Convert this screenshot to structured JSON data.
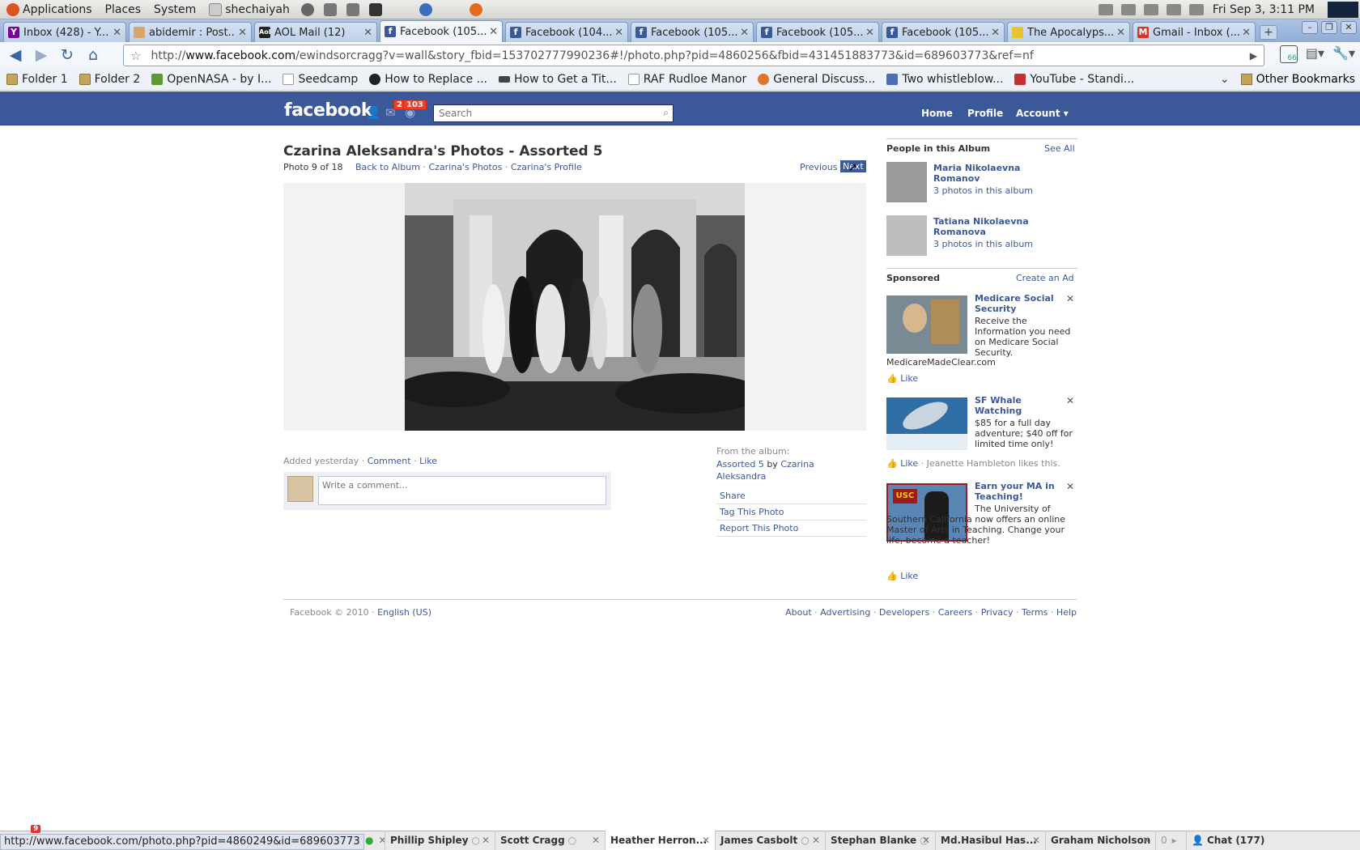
{
  "gnome_panel": {
    "menus": [
      "Applications",
      "Places",
      "System"
    ],
    "user": "shechaiyah",
    "clock": "Fri Sep  3,  3:11 PM"
  },
  "browser": {
    "tabs": [
      {
        "title": "Inbox (428) - Y...",
        "icon": "yahoo-icon",
        "active": false
      },
      {
        "title": "abidemir : Post...",
        "icon": "page-icon",
        "active": false
      },
      {
        "title": "AOL Mail (12)",
        "icon": "aol-icon",
        "active": false
      },
      {
        "title": "Facebook (105...",
        "icon": "facebook-icon",
        "active": true
      },
      {
        "title": "Facebook (104...",
        "icon": "facebook-icon",
        "active": false
      },
      {
        "title": "Facebook (105...",
        "icon": "facebook-icon",
        "active": false
      },
      {
        "title": "Facebook (105...",
        "icon": "facebook-icon",
        "active": false
      },
      {
        "title": "Facebook (105...",
        "icon": "facebook-icon",
        "active": false
      },
      {
        "title": "The Apocalyps...",
        "icon": "page-icon",
        "active": false
      },
      {
        "title": "Gmail - Inbox (...",
        "icon": "gmail-icon",
        "active": false
      }
    ],
    "url_prefix": "http://",
    "url_domain": "www.facebook.com",
    "url_rest": "/ewindsorcragg?v=wall&story_fbid=153702777990236#!/photo.php?pid=4860256&fbid=431451883773&id=689603773&ref=nf",
    "extension_badge": "66",
    "bookmarks": [
      "Folder 1",
      "Folder 2",
      "OpenNASA - by I...",
      "Seedcamp",
      "How to Replace ...",
      "How to Get a Tit...",
      "RAF Rudloe Manor",
      "General Discuss...",
      "Two whistleblow...",
      "YouTube - Standi..."
    ],
    "other_bookmarks": "Other Bookmarks",
    "status_url": "http://www.facebook.com/photo.php?pid=4860249&id=689603773"
  },
  "facebook": {
    "logo": "facebook",
    "notif_badge_1": "2",
    "notif_badge_2": "103",
    "search_placeholder": "Search",
    "nav": {
      "home": "Home",
      "profile": "Profile",
      "account": "Account ▾"
    },
    "album_title": "Czarina Aleksandra's Photos - Assorted 5",
    "photo_count": "Photo 9 of 18",
    "links": {
      "back": "Back to Album",
      "photos": "Czarina's Photos",
      "profile": "Czarina's Profile",
      "prev": "Previous",
      "next": "Next"
    },
    "added": "Added yesterday",
    "comment": "Comment",
    "like": "Like",
    "comment_placeholder": "Write a comment...",
    "from_album_label": "From the album:",
    "from_album_name": "Assorted 5",
    "from_album_by": "by",
    "from_album_owner": "Czarina Aleksandra",
    "actions": [
      "Share",
      "Tag This Photo",
      "Report This Photo"
    ],
    "people_header": "People in this Album",
    "see_all": "See All",
    "people": [
      {
        "name": "Maria Nikolaevna Romanov",
        "sub": "3 photos in this album"
      },
      {
        "name": "Tatiana Nikolaevna Romanova",
        "sub": "3 photos in this album"
      }
    ],
    "sponsored": "Sponsored",
    "create_ad": "Create an Ad",
    "ads": [
      {
        "title": "Medicare Social Security",
        "body": "Receive the Information you need on Medicare Social Security.",
        "domain": "MedicareMadeClear.com",
        "like": "Like",
        "extra": ""
      },
      {
        "title": "SF Whale Watching",
        "body": "$85 for a full day adventure; $40 off for limited time only!",
        "domain": "",
        "like": "Like",
        "extra": "Jeanette Hambleton likes this."
      },
      {
        "title": "Earn your MA in Teaching!",
        "body": "The University of Southern California now offers an online Master of Arts in Teaching. Change your life, become a teacher!",
        "domain": "",
        "like": "Like",
        "extra": ""
      }
    ],
    "ad_logo_usc": "USC",
    "footer_copy": "Facebook © 2010 ·",
    "footer_lang": "English (US)",
    "footer_links": [
      "About",
      "Advertising",
      "Developers",
      "Careers",
      "Privacy",
      "Terms",
      "Help"
    ],
    "chat_tabs": [
      "Phillip Shipley",
      "Scott Cragg",
      "Heather Herron...",
      "James Casbolt",
      "Stephan Blanke",
      "Md.Hasibul Has...",
      "Graham Nicholson"
    ],
    "chat_count_label": "Chat (177)",
    "chat_notif": "9",
    "chat_overflow": "0"
  },
  "colors": {
    "fb_blue": "#3b5998",
    "notif_red": "#f03d25"
  }
}
